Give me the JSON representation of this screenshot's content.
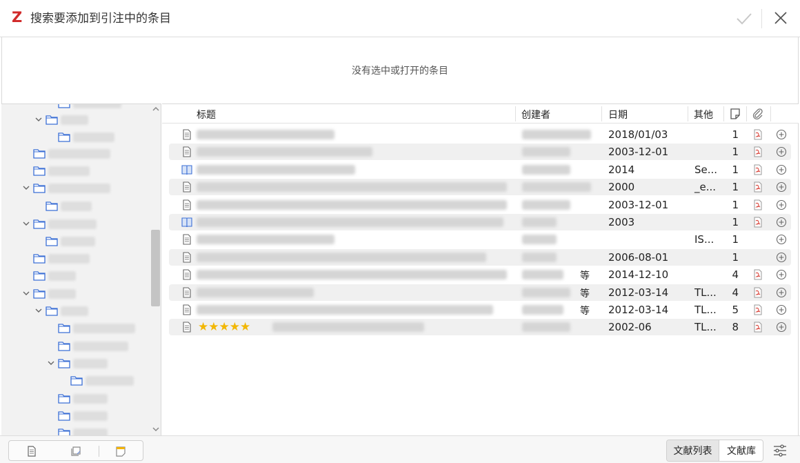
{
  "window": {
    "logo": "Z",
    "title": "搜索要添加到引注中的条目"
  },
  "preview": {
    "message": "没有选中或打开的条目"
  },
  "columns": {
    "title": "标题",
    "creator": "创建者",
    "date": "日期",
    "extra": "其他"
  },
  "items": [
    {
      "type": "document",
      "stars": "",
      "creator": "",
      "date": "2018/01/03",
      "extra": "",
      "notes": "1",
      "pdf": true
    },
    {
      "type": "document",
      "stars": "",
      "creator": "",
      "date": "2003-12-01",
      "extra": "",
      "notes": "1",
      "pdf": true
    },
    {
      "type": "book",
      "stars": "",
      "creator": "",
      "date": "2014",
      "extra": "Se...",
      "notes": "1",
      "pdf": true
    },
    {
      "type": "document",
      "stars": "",
      "creator": "",
      "date": "2000",
      "extra": "_e...",
      "notes": "1",
      "pdf": true
    },
    {
      "type": "document",
      "stars": "",
      "creator": "",
      "date": "2003-12-01",
      "extra": "",
      "notes": "1",
      "pdf": true
    },
    {
      "type": "book",
      "stars": "",
      "creator": "",
      "date": "2003",
      "extra": "",
      "notes": "1",
      "pdf": true
    },
    {
      "type": "document",
      "stars": "",
      "creator": "",
      "date": "",
      "extra": "IS...",
      "notes": "1",
      "pdf": false
    },
    {
      "type": "document",
      "stars": "",
      "creator": "",
      "date": "2006-08-01",
      "extra": "",
      "notes": "1",
      "pdf": false
    },
    {
      "type": "document",
      "stars": "",
      "creator": "等",
      "date": "2014-12-10",
      "extra": "",
      "notes": "4",
      "pdf": true
    },
    {
      "type": "document",
      "stars": "",
      "creator": "等",
      "date": "2012-03-14",
      "extra": "TL...",
      "notes": "4",
      "pdf": true
    },
    {
      "type": "document",
      "stars": "",
      "creator": "等",
      "date": "2012-03-14",
      "extra": "TL...",
      "notes": "5",
      "pdf": true
    },
    {
      "type": "document",
      "stars": "★★★★★",
      "creator": "",
      "date": "2002-06",
      "extra": "TL...",
      "notes": "8",
      "pdf": true
    }
  ],
  "bottom": {
    "mode_list": "文献列表",
    "mode_library": "文献库"
  },
  "colors": {
    "accent": "#d12b2b",
    "folder": "#3b6fd6",
    "pdf": "#d9443b"
  }
}
